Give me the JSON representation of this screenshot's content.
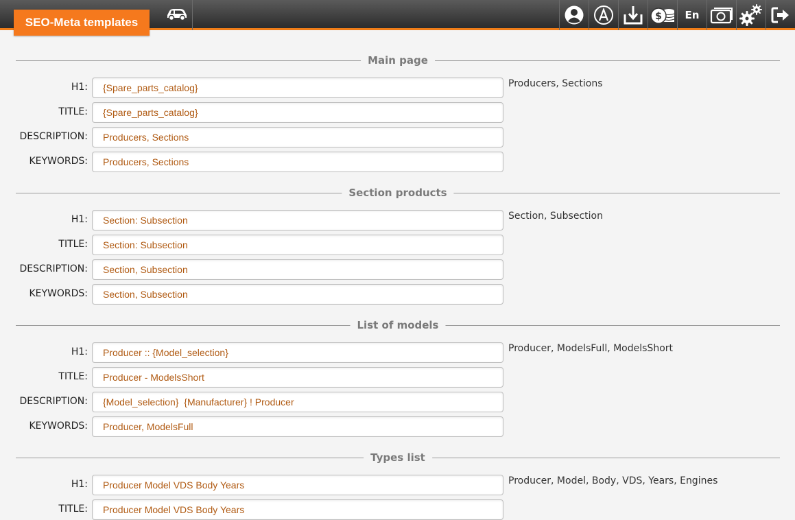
{
  "header": {
    "title": "SEO-Meta templates",
    "language": "En",
    "icons": [
      "car-icon",
      "user-icon",
      "a-circle-icon",
      "download-icon",
      "coins-icon",
      "lang-text",
      "cash-icon",
      "gears-icon",
      "logout-icon"
    ]
  },
  "sections": [
    {
      "title": "Main page",
      "hint": "Producers, Sections",
      "fields": [
        {
          "label": "H1:",
          "value": "{Spare_parts_catalog}"
        },
        {
          "label": "TITLE:",
          "value": "{Spare_parts_catalog}"
        },
        {
          "label": "DESCRIPTION:",
          "value": "Producers, Sections"
        },
        {
          "label": "KEYWORDS:",
          "value": "Producers, Sections"
        }
      ]
    },
    {
      "title": "Section products",
      "hint": "Section, Subsection",
      "fields": [
        {
          "label": "H1:",
          "value": "Section: Subsection"
        },
        {
          "label": "TITLE:",
          "value": "Section: Subsection"
        },
        {
          "label": "DESCRIPTION:",
          "value": "Section, Subsection"
        },
        {
          "label": "KEYWORDS:",
          "value": "Section, Subsection"
        }
      ]
    },
    {
      "title": "List of models",
      "hint": "Producer, ModelsFull, ModelsShort",
      "fields": [
        {
          "label": "H1:",
          "value": "Producer :: {Model_selection}"
        },
        {
          "label": "TITLE:",
          "value": "Producer - ModelsShort"
        },
        {
          "label": "DESCRIPTION:",
          "value": "{Model_selection}  {Manufacturer} ! Producer"
        },
        {
          "label": "KEYWORDS:",
          "value": "Producer, ModelsFull"
        }
      ]
    },
    {
      "title": "Types list",
      "hint": "Producer, Model, Body, VDS, Years, Engines",
      "fields": [
        {
          "label": "H1:",
          "value": "Producer Model VDS Body Years"
        },
        {
          "label": "TITLE:",
          "value": "Producer Model VDS Body Years"
        }
      ]
    }
  ],
  "colors": {
    "accent": "#f5791d",
    "input_text": "#b05a12",
    "topbar": "#3a3a3a"
  }
}
